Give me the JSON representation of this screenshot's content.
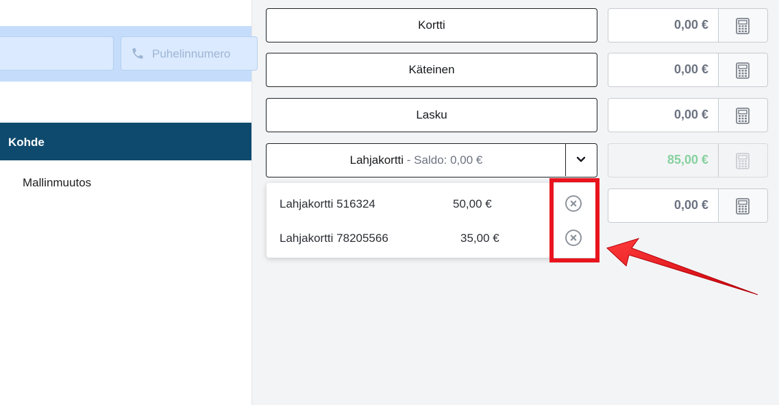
{
  "contact": {
    "phone_placeholder": "Puhelinnumero"
  },
  "sidebar": {
    "section_title": "Kohde",
    "items": [
      "Mallinmuutos"
    ]
  },
  "payments": [
    {
      "label": "Kortti",
      "amount": "0,00 €"
    },
    {
      "label": "Käteinen",
      "amount": "0,00 €"
    },
    {
      "label": "Lasku",
      "amount": "0,00 €"
    }
  ],
  "giftcard": {
    "label": "Lahjakortti",
    "balance_text": "- Saldo: 0,00 €",
    "amount": "85,00 €",
    "extra_amount": "0,00 €",
    "cards": [
      {
        "name": "Lahjakortti 516324",
        "amount": "50,00 €"
      },
      {
        "name": "Lahjakortti 78205566",
        "amount": "35,00 €"
      }
    ]
  },
  "colors": {
    "kohde_bar": "#0e4a6e",
    "contact_band": "#c5ddfb",
    "highlight": "#e8141e",
    "giftcard_amount": "#86d19f"
  },
  "icons": [
    "phone-icon",
    "calculator-icon",
    "chevron-down-icon",
    "remove-circle-icon",
    "arrow-annotation"
  ]
}
